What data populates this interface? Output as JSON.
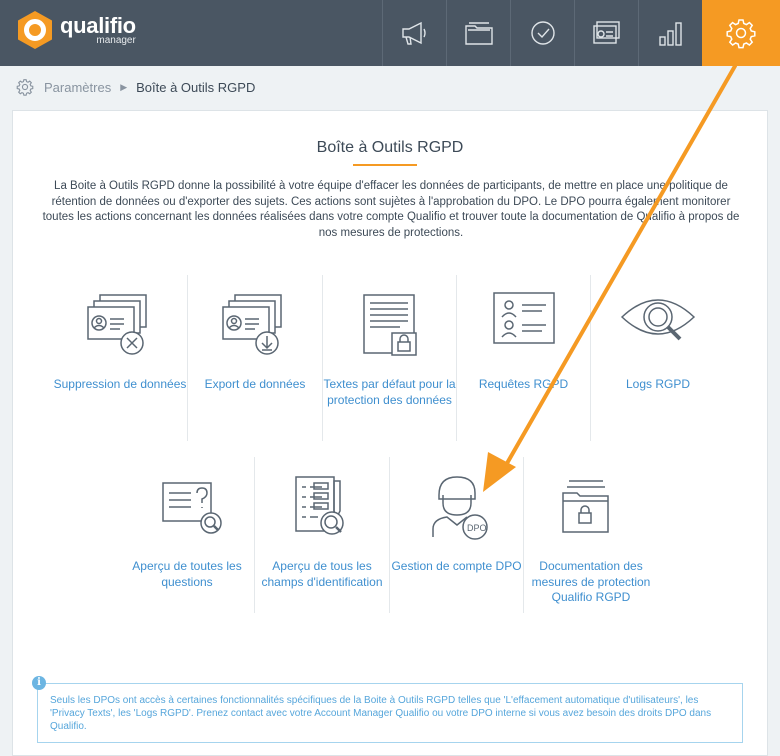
{
  "brand": {
    "name": "qualifio",
    "sub": "manager"
  },
  "nav": [
    {
      "icon": "megaphone-icon"
    },
    {
      "icon": "folder-icon"
    },
    {
      "icon": "check-circle-icon"
    },
    {
      "icon": "contacts-icon"
    },
    {
      "icon": "bar-chart-icon"
    },
    {
      "icon": "gear-icon",
      "active": true
    }
  ],
  "colors": {
    "accent": "#f59a23",
    "topbar": "#4a5663",
    "link": "#3f8fcf",
    "info": "#56a6db"
  },
  "breadcrumb": {
    "parent": "Paramètres",
    "current": "Boîte à Outils RGPD"
  },
  "main": {
    "title": "Boîte à Outils RGPD",
    "description": "La Boite à Outils RGPD donne la possibilité à votre équipe d'effacer les données de participants, de mettre en place une politique de rétention de données ou d'exporter des sujets. Ces actions sont sujètes à l'approbation du DPO. Le DPO pourra également monitorer toutes les actions concernant les données réalisées dans votre compte Qualifio et trouver toute la documentation de Qualifio à propos de nos mesures de protections.",
    "tiles_row1": [
      {
        "label": "Suppression de données",
        "icon": "id-card-delete-icon"
      },
      {
        "label": "Export de données",
        "icon": "id-card-download-icon"
      },
      {
        "label": "Textes par défaut pour la protection des données",
        "icon": "document-lock-icon"
      },
      {
        "label": "Requêtes RGPD",
        "icon": "request-list-icon"
      },
      {
        "label": "Logs RGPD",
        "icon": "eye-search-icon"
      }
    ],
    "tiles_row2": [
      {
        "label": "Aperçu de toutes les questions",
        "icon": "question-search-icon"
      },
      {
        "label": "Aperçu de tous les champs d'identification",
        "icon": "form-search-icon"
      },
      {
        "label": "Gestion de compte DPO",
        "icon": "dpo-user-icon"
      },
      {
        "label": "Documentation des mesures de protection Qualifio RGPD",
        "icon": "folder-lock-icon"
      }
    ],
    "info": {
      "icon_text": "i",
      "text": "Seuls les DPOs ont accès à certaines fonctionnalités spécifiques de la Boite à Outils RGPD telles que 'L'effacement automatique d'utilisateurs', les 'Privacy Texts', les 'Logs RGPD'. Prenez contact avec votre Account Manager Qualifio ou votre DPO interne si vous avez besoin des droits DPO dans Qualifio."
    }
  }
}
